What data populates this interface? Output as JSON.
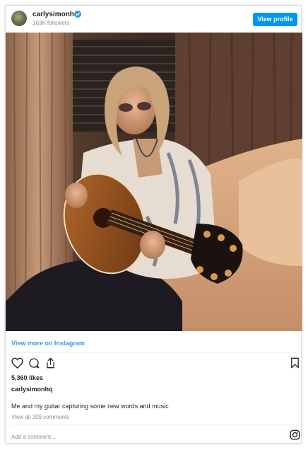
{
  "header": {
    "username": "carlysimonhq",
    "followers": "163K followers",
    "view_profile_label": "View profile",
    "verified_icon": "verified-badge-icon"
  },
  "post": {
    "image_alt": "Carly Simon playing a Taylor acoustic guitar on a couch"
  },
  "links": {
    "view_more": "View more on Instagram"
  },
  "actions": {
    "like_icon": "heart-icon",
    "comment_icon": "comment-icon",
    "share_icon": "share-icon",
    "save_icon": "bookmark-icon"
  },
  "stats": {
    "likes": "5,360 likes"
  },
  "caption": {
    "author": "carlysimonhq",
    "text": "Me and my guitar capturing some new words and music",
    "view_comments": "View all 209 comments"
  },
  "footer": {
    "add_comment_placeholder": "Add a comment...",
    "instagram_icon": "instagram-logo-icon"
  },
  "colors": {
    "accent": "#0095f6",
    "link": "#3897f0",
    "muted": "#8e8e8e",
    "text": "#262626",
    "border": "#dbdbdb"
  }
}
